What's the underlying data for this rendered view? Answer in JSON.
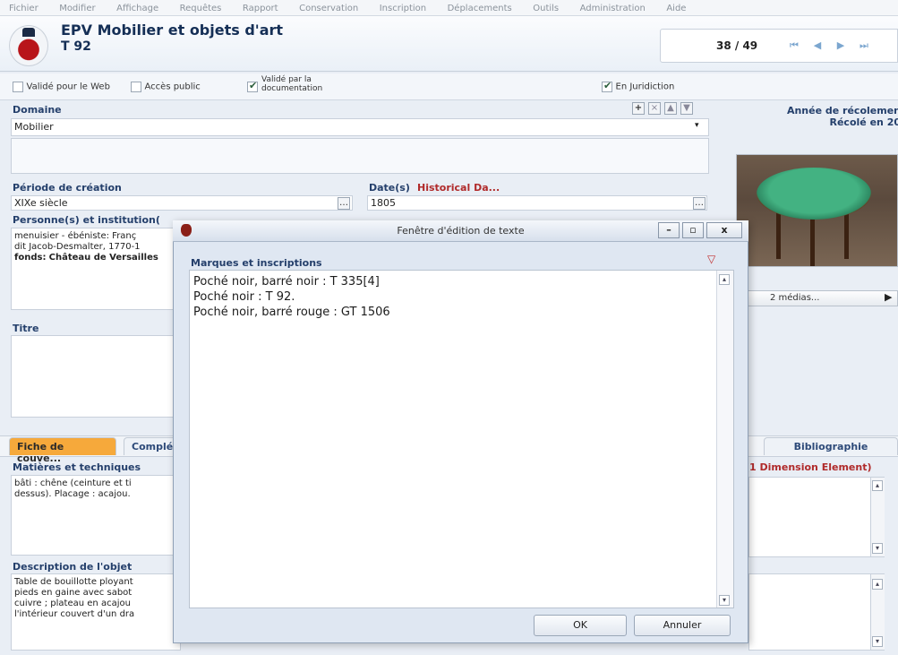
{
  "menu": {
    "items": [
      "Fichier",
      "Modifier",
      "Affichage",
      "Requêtes",
      "Rapport",
      "Conservation",
      "Inscription",
      "Déplacements",
      "Outils",
      "Administration",
      "Aide"
    ]
  },
  "header": {
    "title": "EPV Mobilier et objets d'art",
    "record_id": "T 92",
    "record_counter": "38 / 49",
    "nav": {
      "first": "⏮",
      "prev": "◀",
      "next": "▶",
      "last": "⏭"
    }
  },
  "flags": {
    "valide_web": "Validé pour le Web",
    "acces_public": "Accès public",
    "valide_doc_line1": "Validé par la",
    "valide_doc_line2": "documentation",
    "en_juridiction": "En Juridiction"
  },
  "form": {
    "domaine_label": "Domaine",
    "domaine_value": "Mobilier",
    "periode_label": "Période de création",
    "periode_value": "XIXe siècle",
    "dates_label": "Date(s)",
    "historical_label": "Historical Da...",
    "date_value": "1805",
    "personnes_label": "Personne(s) et institution(",
    "personnes_line1": "menuisier - ébéniste: Franç",
    "personnes_line2": "dit Jacob-Desmalter, 1770-1",
    "personnes_line3_label": "fonds:",
    "personnes_line3_value": "Château de Versailles",
    "titre_label": "Titre",
    "matieres_label": "Matières et techniques",
    "matieres_line1": "bâti : chêne (ceinture et ti",
    "matieres_line2": "dessus). Placage : acajou.",
    "description_label": "Description de l'objet",
    "description_lines": [
      "Table de bouillotte ployant",
      "pieds en gaine avec sabot",
      "cuivre ; plateau en acajou",
      "l'intérieur couvert d'un dra"
    ]
  },
  "right_panel": {
    "annee_label": "Année de récolemen",
    "recole_value": "Récolé en 20",
    "medias_label": "2 médias..."
  },
  "tabs": {
    "fiche": "Fiche de couve...",
    "complement": "Complé",
    "bibliographie": "Bibliographie",
    "dimension_label": "(1 Dimension Element)"
  },
  "dialog": {
    "title": "Fenêtre d'édition de texte",
    "heading": "Marques et inscriptions",
    "lines": [
      "Poché noir, barré noir : T 335[4]",
      "Poché noir : T 92.",
      "Poché noir, barré rouge : GT 1506"
    ],
    "ok_label": "OK",
    "cancel_label": "Annuler",
    "min_label": "–",
    "max_label": "▫",
    "close_label": "x"
  },
  "colors": {
    "accent_tab": "#f6a93b",
    "label_blue": "#243f6b",
    "label_red": "#b02a2a"
  }
}
